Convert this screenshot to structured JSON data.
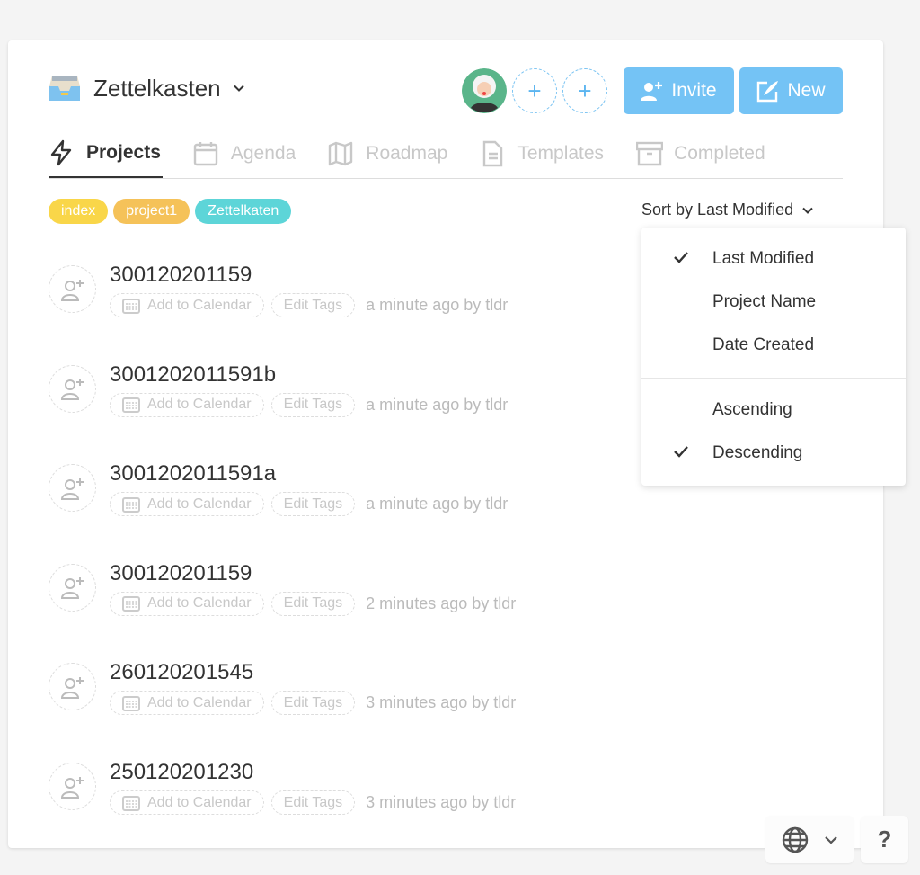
{
  "workspace": {
    "title": "Zettelkasten"
  },
  "header": {
    "invite_label": "Invite",
    "new_label": "New",
    "accent": "#74c3f5"
  },
  "tabs": [
    {
      "label": "Projects",
      "icon": "lightning-icon",
      "active": true
    },
    {
      "label": "Agenda",
      "icon": "calendar-icon"
    },
    {
      "label": "Roadmap",
      "icon": "map-icon"
    },
    {
      "label": "Templates",
      "icon": "document-icon"
    },
    {
      "label": "Completed",
      "icon": "archive-icon"
    }
  ],
  "tags": [
    {
      "label": "index",
      "color": "#f9d649"
    },
    {
      "label": "project1",
      "color": "#f5c259"
    },
    {
      "label": "Zettelkaten",
      "color": "#5dd5d8"
    }
  ],
  "sort": {
    "label": "Sort by Last Modified",
    "options": [
      {
        "label": "Last Modified",
        "checked": true
      },
      {
        "label": "Project Name",
        "checked": false
      },
      {
        "label": "Date Created",
        "checked": false
      }
    ],
    "order": [
      {
        "label": "Ascending",
        "checked": false
      },
      {
        "label": "Descending",
        "checked": true
      }
    ]
  },
  "row_labels": {
    "calendar": "Add to Calendar",
    "tags": "Edit Tags"
  },
  "projects": [
    {
      "name": "300120201159",
      "modified": "a minute ago by tldr"
    },
    {
      "name": "3001202011591b",
      "modified": "a minute ago by tldr"
    },
    {
      "name": "3001202011591a",
      "modified": "a minute ago by tldr"
    },
    {
      "name": "300120201159",
      "modified": "2 minutes ago by tldr"
    },
    {
      "name": "260120201545",
      "modified": "3 minutes ago by tldr"
    },
    {
      "name": "250120201230",
      "modified": "3 minutes ago by tldr"
    }
  ],
  "footer": {
    "help_label": "?"
  }
}
